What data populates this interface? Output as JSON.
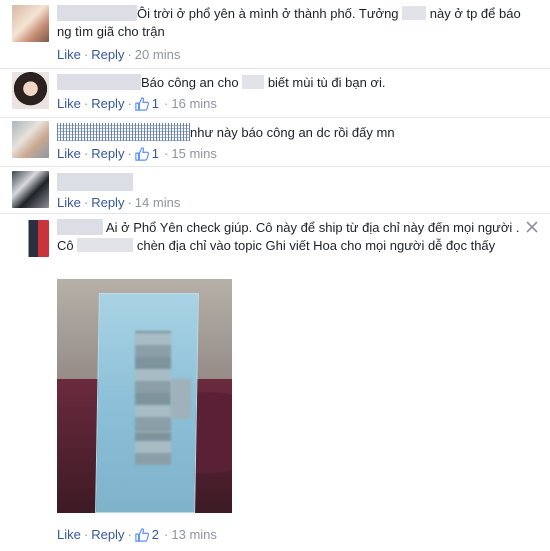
{
  "actions": {
    "like": "Like",
    "reply": "Reply",
    "separator": "·"
  },
  "comments": [
    {
      "id": "c1",
      "text_a": "Ôi trời ở phổ yên à mình ở thành phố. Tưởng ",
      "text_b": " này ở tp để báo ng tìm giã cho trận",
      "likes": "",
      "time": "20 mins"
    },
    {
      "id": "c2",
      "text_a": "Báo công an cho ",
      "text_b": " biết mùi tù đi bạn ơi.",
      "likes": "1",
      "time": "16 mins"
    },
    {
      "id": "c3",
      "text_a": "như này báo công an dc rồi đấy mn",
      "likes": "1",
      "time": "15 mins"
    },
    {
      "id": "c4",
      "likes": "",
      "time": "14 mins"
    },
    {
      "id": "c5",
      "text_a": "Ai ở Phổ Yên check giúp. Cô này để ship từ địa chỉ này đến mọi người . Cô ",
      "text_b": " chèn địa chỉ vào topic Ghi viết Hoa cho mọi người dễ đọc thấy",
      "likes": "2",
      "time": "13 mins"
    }
  ],
  "icons": {
    "like": "thumbs-up-icon",
    "close": "close-icon"
  },
  "colors": {
    "link": "#365899",
    "meta": "#90949c",
    "text": "#1d2129",
    "divider": "#e5e6e9"
  }
}
